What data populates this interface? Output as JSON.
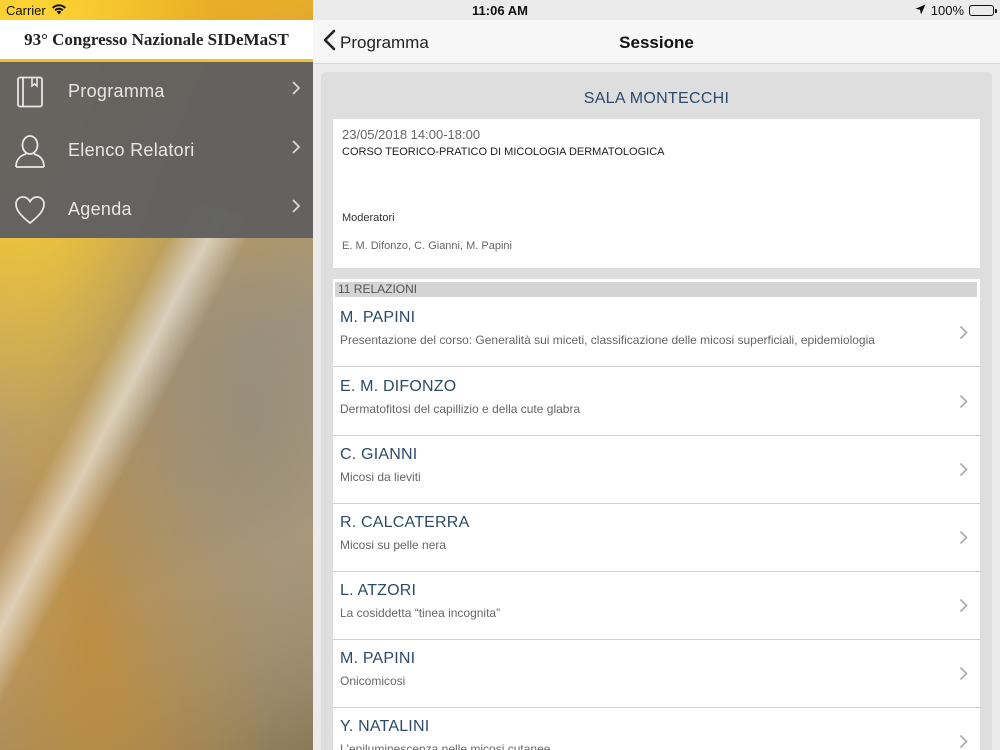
{
  "status_bar": {
    "carrier": "Carrier",
    "time": "11:06 AM",
    "battery": "100%",
    "battery_level": 1.0
  },
  "sidebar": {
    "title": "93° Congresso Nazionale SIDeMaST",
    "items": [
      {
        "label": "Programma",
        "icon": "book-icon"
      },
      {
        "label": "Elenco Relatori",
        "icon": "person-icon"
      },
      {
        "label": "Agenda",
        "icon": "heart-icon"
      }
    ]
  },
  "navbar": {
    "back_label": "Programma",
    "title": "Sessione"
  },
  "session": {
    "room": "SALA MONTECCHI",
    "datetime": "23/05/2018 14:00-18:00",
    "name": "CORSO TEORICO-PRATICO DI MICOLOGIA DERMATOLOGICA",
    "moderators_label": "Moderatori",
    "moderators": "E. M. Difonzo, C. Gianni, M. Papini"
  },
  "relazioni": {
    "header": "11 RELAZIONI",
    "items": [
      {
        "name": "M. PAPINI",
        "desc": "Presentazione del corso: Generalità sui miceti, classificazione delle micosi superficiali, epidemiologia"
      },
      {
        "name": "E. M. DIFONZO",
        "desc": "Dermatofitosi del capillizio e della cute glabra"
      },
      {
        "name": "C. GIANNI",
        "desc": "Micosi da lieviti"
      },
      {
        "name": "R. CALCATERRA",
        "desc": "Micosi su pelle nera"
      },
      {
        "name": "L. ATZORI",
        "desc": "La cosiddetta “tinea incognita”"
      },
      {
        "name": "M. PAPINI",
        "desc": "Onicomicosi"
      },
      {
        "name": "Y.  NATALINI",
        "desc": "L'epiluminescenza nelle micosi cutanee"
      }
    ]
  }
}
